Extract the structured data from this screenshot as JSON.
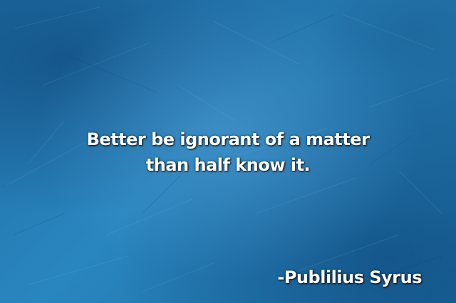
{
  "quote": {
    "line1": "Better be ignorant of a matter",
    "line2": "than half know it."
  },
  "author": "-Publilius Syrus",
  "colors": {
    "background": "#2277b0",
    "text": "#ffffff"
  }
}
